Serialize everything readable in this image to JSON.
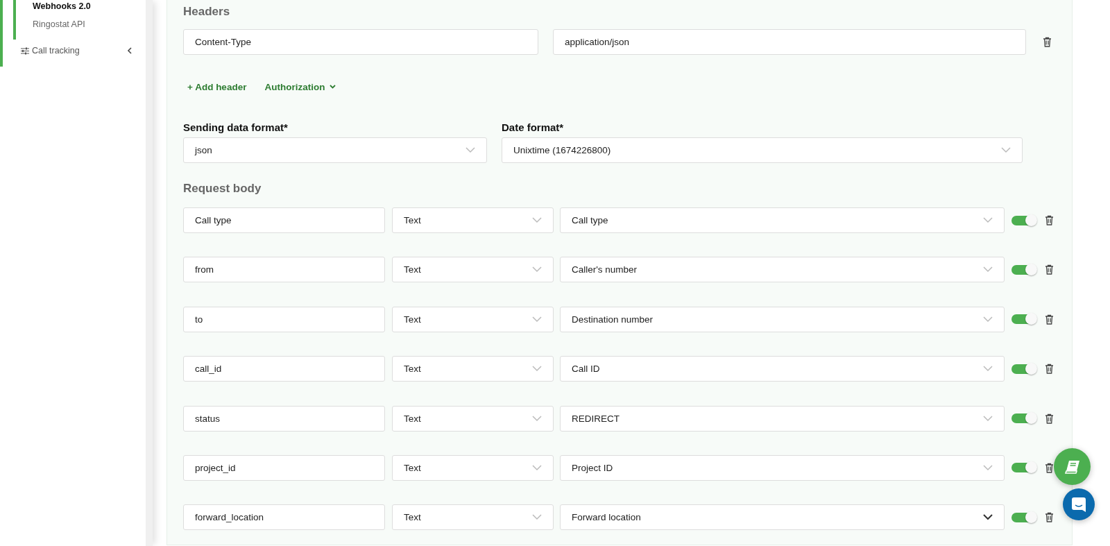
{
  "sidebar": {
    "items": [
      {
        "label": "Webhooks 2.0",
        "selected": true
      },
      {
        "label": "Ringostat API",
        "selected": false
      }
    ],
    "section": {
      "label": "Call tracking",
      "expanded": false
    }
  },
  "headers": {
    "title": "Headers",
    "rows": [
      {
        "name": "Content-Type",
        "value": "application/json"
      }
    ],
    "add_label": "+ Add header",
    "auth_label": "Authorization"
  },
  "formats": [
    {
      "label": "Sending data format*",
      "value": "json"
    },
    {
      "label": "Date format*",
      "value": "Unixtime (1674226800)"
    }
  ],
  "request_body": {
    "title": "Request body",
    "rows": [
      {
        "name": "Call type",
        "type": "Text",
        "value": "Call type",
        "on": true,
        "focused": false
      },
      {
        "name": "from",
        "type": "Text",
        "value": "Caller's number",
        "on": true,
        "focused": false
      },
      {
        "name": "to",
        "type": "Text",
        "value": "Destination number",
        "on": true,
        "focused": false
      },
      {
        "name": "call_id",
        "type": "Text",
        "value": "Call ID",
        "on": true,
        "focused": false
      },
      {
        "name": "status",
        "type": "Text",
        "value": "REDIRECT",
        "on": true,
        "focused": false
      },
      {
        "name": "project_id",
        "type": "Text",
        "value": "Project ID",
        "on": true,
        "focused": false
      },
      {
        "name": "forward_location",
        "type": "Text",
        "value": "Forward location",
        "on": true,
        "focused": true
      }
    ]
  }
}
